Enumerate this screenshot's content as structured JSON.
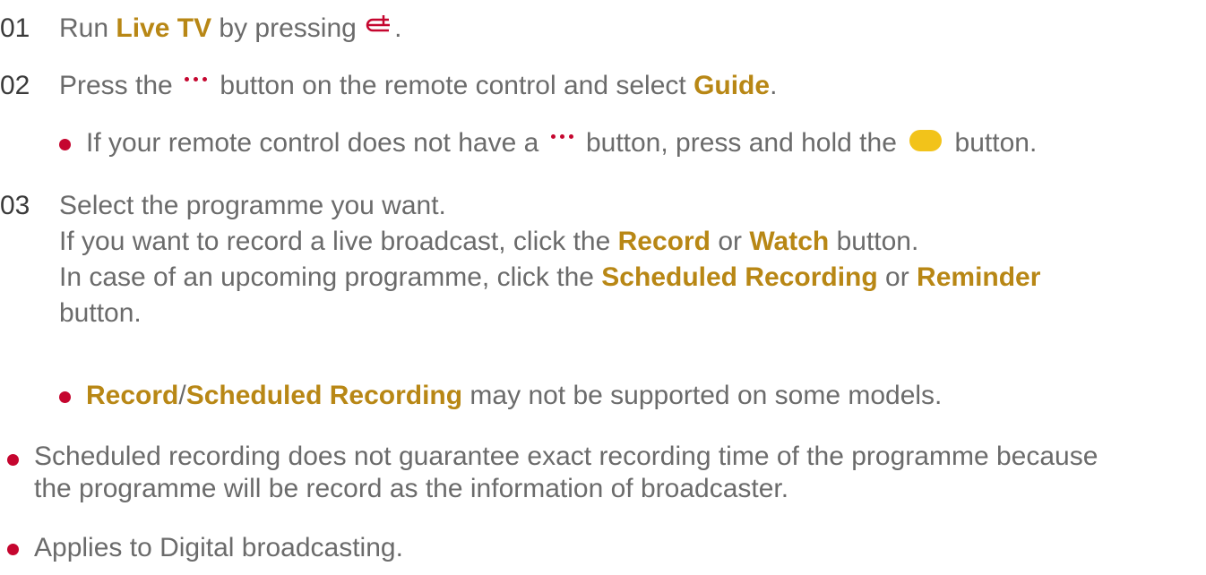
{
  "colors": {
    "highlight": "#b88715",
    "accent_red": "#c5062f",
    "yellow_button": "#f2c31a",
    "text": "#6b6b6b",
    "number": "#3a3a3a"
  },
  "step1": {
    "number": "01",
    "pre": "Run ",
    "live_tv": "Live TV",
    "mid": " by pressing ",
    "icon": "live-tv-icon",
    "post": "."
  },
  "step2": {
    "number": "02",
    "pre": "Press the ",
    "icon": "more-dots-icon",
    "mid": " button on the remote control and select ",
    "guide": "Guide",
    "post": "."
  },
  "note2": {
    "pre": "If your remote control does not have a ",
    "icon": "more-dots-icon",
    "mid": " button, press and hold the ",
    "button_icon": "yellow-button-icon",
    "post": " button."
  },
  "step3": {
    "number": "03",
    "line1": "Select the programme you want.",
    "line2_pre": "If you want to record a live broadcast, click the ",
    "record": "Record",
    "or1": " or ",
    "watch": "Watch",
    "line2_post": " button.",
    "line3_pre": "In case of an upcoming programme, click the ",
    "scheduled": "Scheduled Recording",
    "or2": " or ",
    "reminder": "Reminder",
    "line4": "button."
  },
  "note3": {
    "record": "Record",
    "slash": "/",
    "scheduled": "Scheduled Recording",
    "post": " may not be supported on some models."
  },
  "footnotes": [
    {
      "line1": "Scheduled recording does not guarantee exact recording time of the programme because",
      "line2": "the programme will be record as the information of broadcaster."
    },
    {
      "line1": "Applies to Digital broadcasting."
    }
  ]
}
